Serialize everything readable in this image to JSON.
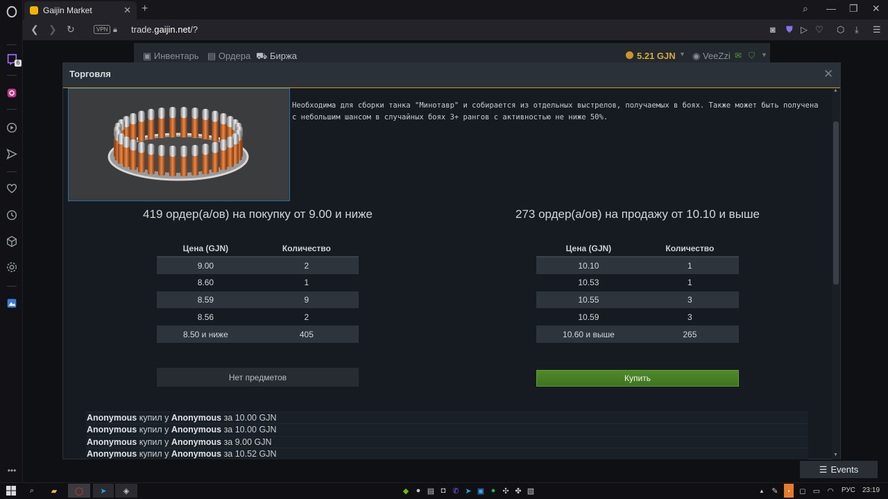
{
  "browser": {
    "tab_title": "Gaijin Market",
    "url_prefix": "trade.",
    "url_domain": "gaijin.net",
    "url_suffix": "/?",
    "vpn_label": "VPN",
    "sidebar_badge": "6"
  },
  "site_nav": {
    "inventory": "Инвентарь",
    "orders": "Ордера",
    "exchange": "Биржа",
    "balance": "5.21 GJN",
    "username": "VeeZzi"
  },
  "modal": {
    "title": "Торговля",
    "description_line1": "Необходима для сборки танка \"Минотавр\" и собирается из отдельных выстрелов, получаемых в боях. Также может быть получена",
    "description_line2": "с небольшим шансом в случайных боях 3+ рангов с активностью не ниже 50%.",
    "buy_orders": {
      "heading": "419 ордер(а/ов) на покупку от 9.00 и ниже",
      "col_price": "Цена (GJN)",
      "col_qty": "Количество",
      "rows": [
        {
          "price": "9.00",
          "qty": "2"
        },
        {
          "price": "8.60",
          "qty": "1"
        },
        {
          "price": "8.59",
          "qty": "9"
        },
        {
          "price": "8.56",
          "qty": "2"
        },
        {
          "price": "8.50 и ниже",
          "qty": "405"
        }
      ],
      "button": "Нет предметов"
    },
    "sell_orders": {
      "heading": "273 ордер(а/ов) на продажу от 10.10 и выше",
      "col_price": "Цена (GJN)",
      "col_qty": "Количество",
      "rows": [
        {
          "price": "10.10",
          "qty": "1"
        },
        {
          "price": "10.53",
          "qty": "1"
        },
        {
          "price": "10.55",
          "qty": "3"
        },
        {
          "price": "10.59",
          "qty": "3"
        },
        {
          "price": "10.60 и выше",
          "qty": "265"
        }
      ],
      "button": "Купить"
    },
    "history": [
      {
        "buyer": "Anonymous",
        "verb": "купил у",
        "seller": "Anonymous",
        "amount": "за 10.00 GJN"
      },
      {
        "buyer": "Anonymous",
        "verb": "купил у",
        "seller": "Anonymous",
        "amount": "за 10.00 GJN"
      },
      {
        "buyer": "Anonymous",
        "verb": "купил у",
        "seller": "Anonymous",
        "amount": "за 9.00 GJN"
      },
      {
        "buyer": "Anonymous",
        "verb": "купил у",
        "seller": "Anonymous",
        "amount": "за 10.52 GJN"
      }
    ]
  },
  "events_button": "Events",
  "taskbar": {
    "language": "РУС",
    "time": "23:19"
  },
  "colors": {
    "accent_gold": "#c89a2a",
    "buy_green": "#4f8a2a",
    "row_alt": "#2d343c"
  }
}
